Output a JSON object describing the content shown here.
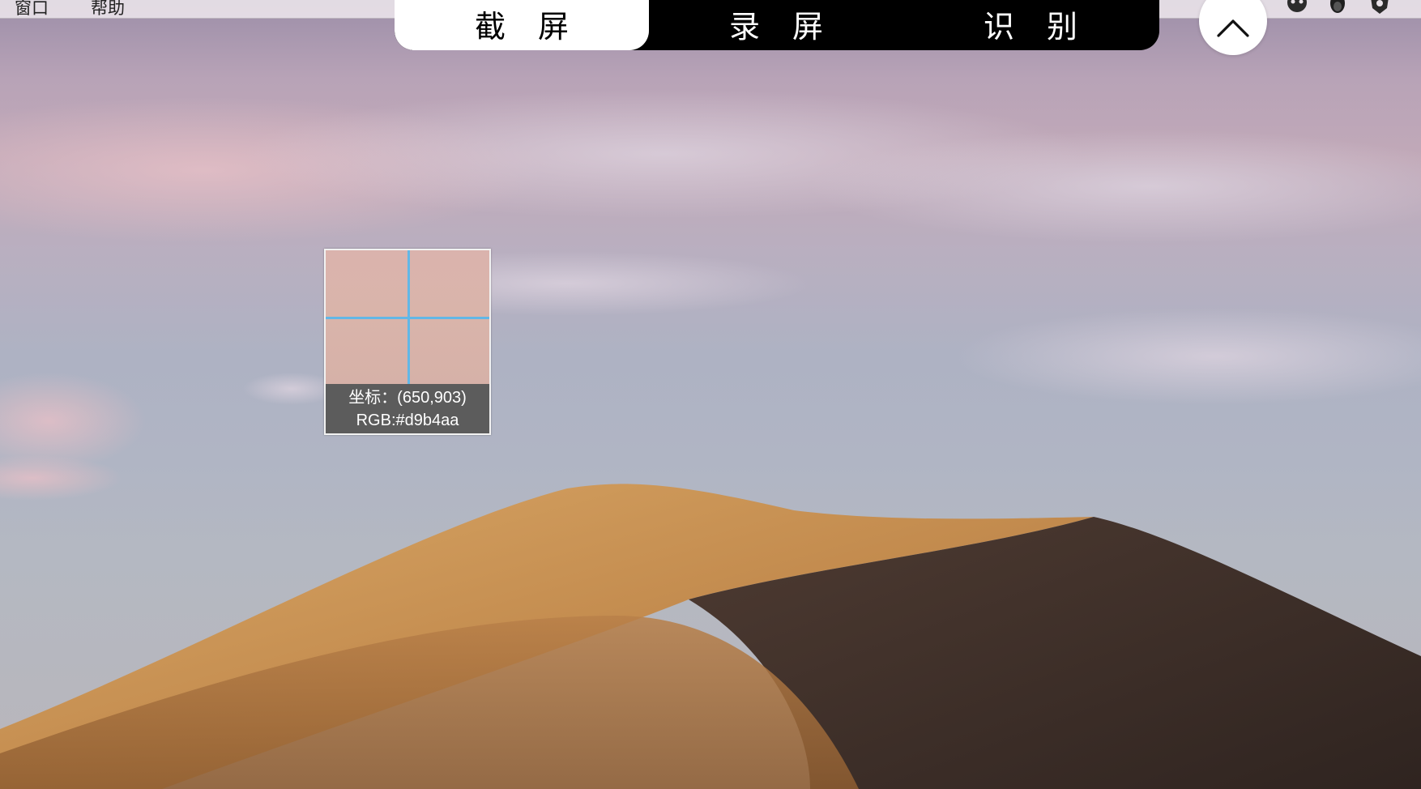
{
  "menubar": {
    "items": [
      {
        "label": "窗口"
      },
      {
        "label": "帮助"
      }
    ],
    "tray_icons": [
      "cat-face-icon",
      "penguin-icon",
      "shield-icon"
    ]
  },
  "toolbar": {
    "tabs": [
      {
        "label": "截 屏",
        "active": true
      },
      {
        "label": "录 屏",
        "active": false
      },
      {
        "label": "识 别",
        "active": false
      }
    ],
    "collapse_icon": "chevron-up-icon"
  },
  "magnifier": {
    "coord_text": "坐标：(650,903)",
    "rgb_text": "RGB:#d9b4aa",
    "sampled_color": "#d9b4aa",
    "crosshair_color": "#62b7e6"
  },
  "colors": {
    "toolbar_bg": "#000000",
    "active_tab_bg": "#ffffff",
    "info_bg": "#5c5c5c"
  }
}
